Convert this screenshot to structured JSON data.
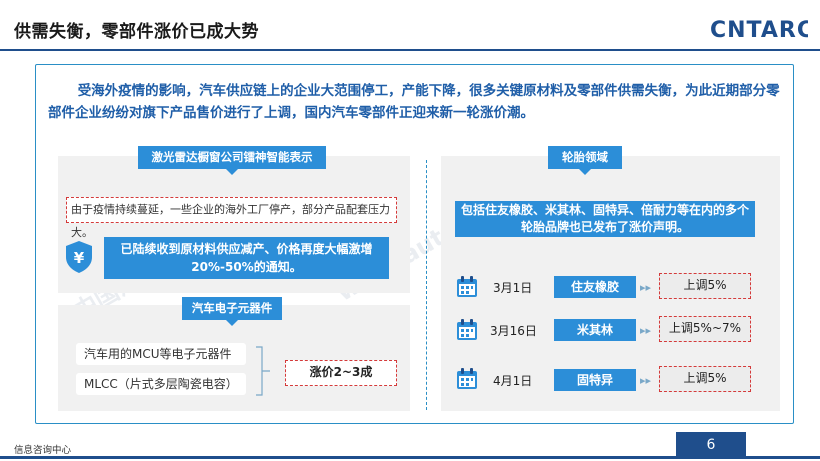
{
  "header": {
    "title": "供需失衡，零部件涨价已成大势",
    "logo_text": "CNTARC"
  },
  "intro": "受海外疫情的影响，汽车供应链上的企业大范围停工，产能下降，很多关键原材料及零部件供需失衡，为此近期部分零部件企业纷纷对旗下产品售价进行了上调，国内汽车零部件正迎来新一轮涨价潮。",
  "left_top": {
    "tag": "激光雷达橱窗公司镭神智能表示",
    "note": "由于疫情持续蔓延，一些企业的海外工厂停产，部分产品配套压力大。",
    "notice_line1": "已陆续收到原材料供应减产、价格再度大幅激增",
    "notice_line2": "20%-50%的通知。",
    "shield_glyph": "¥"
  },
  "left_bottom": {
    "tag": "汽车电子元器件",
    "items": [
      "汽车用的MCU等电子元器件",
      "MLCC（片式多层陶瓷电容）"
    ],
    "rise": "涨价2~3成"
  },
  "right": {
    "tag": "轮胎领域",
    "text_line1": "包括住友橡胶、米其林、固特异、倍耐力等在内的多个",
    "text_line2": "轮胎品牌也已发布了涨价声明。",
    "rows": [
      {
        "date": "3月1日",
        "brand": "住友橡胶",
        "result": "上调5%"
      },
      {
        "date": "3月16日",
        "brand": "米其林",
        "result": "上调5%~7%"
      },
      {
        "date": "4月1日",
        "brand": "固特异",
        "result": "上调5%"
      }
    ],
    "arrow_glyph": "▸▸"
  },
  "footer": {
    "left": "信息咨询中心",
    "page": "6"
  },
  "watermark": [
    "中国汽车工业信息网",
    "www.autoinfo.org.cn"
  ],
  "colors": {
    "accent": "#2c8ed8",
    "brand_navy": "#1f4e8c",
    "intro_text": "#1f5ea8",
    "dash_red": "#d43a3a"
  }
}
